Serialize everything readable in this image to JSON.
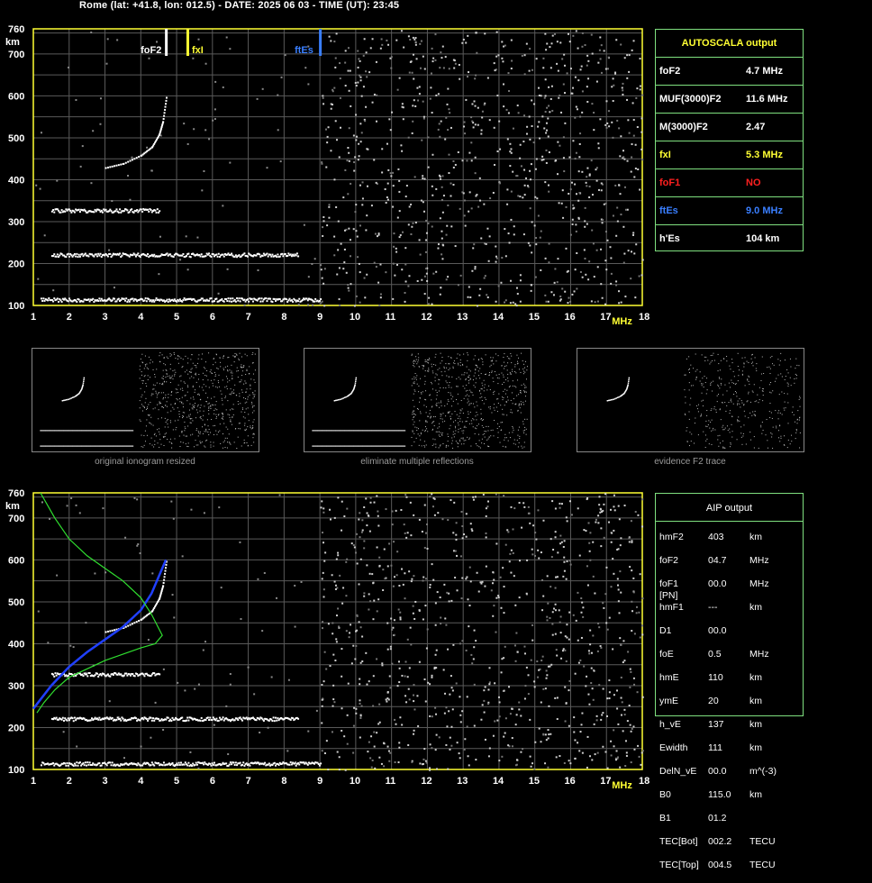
{
  "header": {
    "title": "Rome (lat: +41.8, lon: 012.5) - DATE: 2025 06 03 - TIME (UT): 23:45"
  },
  "axes": {
    "y_unit": "km",
    "x_unit": "MHz",
    "y_ticks": [
      "760",
      "700",
      "600",
      "500",
      "400",
      "300",
      "200",
      "100"
    ],
    "x_ticks": [
      "1",
      "2",
      "3",
      "4",
      "5",
      "6",
      "7",
      "8",
      "9",
      "10",
      "11",
      "12",
      "13",
      "14",
      "15",
      "16",
      "17",
      "18"
    ],
    "xlim": [
      1,
      18
    ],
    "ylim": [
      100,
      760
    ]
  },
  "markers": [
    {
      "label": "foF2",
      "freq": 4.7,
      "color": "#ffffff"
    },
    {
      "label": "fxI",
      "freq": 5.3,
      "color": "#ffff33"
    },
    {
      "label": "ftEs",
      "freq": 9.0,
      "color": "#3a7fff"
    }
  ],
  "autoscala": {
    "title": "AUTOSCALA output",
    "rows": [
      {
        "label": "foF2",
        "value": "4.7 MHz",
        "label_color": "#ffffff",
        "value_color": "#ffffff"
      },
      {
        "label": "MUF(3000)F2",
        "value": "11.6 MHz",
        "label_color": "#ffffff",
        "value_color": "#ffffff"
      },
      {
        "label": "M(3000)F2",
        "value": "2.47",
        "label_color": "#ffffff",
        "value_color": "#ffffff"
      },
      {
        "label": "fxI",
        "value": "5.3 MHz",
        "label_color": "#ffff33",
        "value_color": "#ffff33"
      },
      {
        "label": "foF1",
        "value": "NO",
        "label_color": "#ff2020",
        "value_color": "#ff2020"
      },
      {
        "label": "ftEs",
        "value": "9.0 MHz",
        "label_color": "#3a7fff",
        "value_color": "#3a7fff"
      },
      {
        "label": "h'Es",
        "value": "104    km",
        "label_color": "#ffffff",
        "value_color": "#ffffff"
      }
    ]
  },
  "thumbnails": [
    {
      "caption": "original ionogram resized"
    },
    {
      "caption": "eliminate multiple reflections"
    },
    {
      "caption": "evidence F2 trace"
    }
  ],
  "aip": {
    "title": "AIP output",
    "rows": [
      {
        "name": "hmF2",
        "value": "403",
        "unit": "km",
        "extra": ""
      },
      {
        "name": "foF2",
        "value": "04.7",
        "unit": "MHz",
        "extra": ""
      },
      {
        "name": "foF1",
        "value": "00.0",
        "unit": "MHz",
        "extra": "[PN]"
      },
      {
        "name": "hmF1",
        "value": "---",
        "unit": "km",
        "extra": ""
      },
      {
        "name": "D1",
        "value": "00.0",
        "unit": "",
        "extra": ""
      },
      {
        "name": "foE",
        "value": "0.5",
        "unit": "MHz",
        "extra": ""
      },
      {
        "name": "hmE",
        "value": "110",
        "unit": "km",
        "extra": ""
      },
      {
        "name": "ymE",
        "value": "20",
        "unit": "km",
        "extra": ""
      },
      {
        "name": "h_vE",
        "value": "137",
        "unit": "km",
        "extra": ""
      },
      {
        "name": "Ewidth",
        "value": "111",
        "unit": "km",
        "extra": ""
      },
      {
        "name": "DelN_vE",
        "value": "00.0",
        "unit": "m^(-3)",
        "extra": ""
      },
      {
        "name": "B0",
        "value": "115.0",
        "unit": "km",
        "extra": ""
      },
      {
        "name": "B1",
        "value": "01.2",
        "unit": "",
        "extra": ""
      },
      {
        "name": "TEC[Bot]",
        "value": "002.2",
        "unit": "TECU",
        "extra": ""
      },
      {
        "name": "TEC[Top]",
        "value": "004.5",
        "unit": "TECU",
        "extra": ""
      }
    ]
  },
  "chart_data": [
    {
      "type": "scatter",
      "title": "",
      "xlabel": "MHz",
      "ylabel": "km",
      "xlim": [
        1,
        18
      ],
      "ylim": [
        100,
        760
      ],
      "grid": true,
      "series": [
        {
          "x": [
            1.2,
            2,
            3,
            4,
            5,
            6,
            7,
            8,
            9
          ],
          "y": [
            115,
            115,
            115,
            115,
            115,
            115,
            115,
            115,
            115
          ]
        },
        {
          "x": [
            1.5,
            2,
            3,
            4,
            5,
            6,
            7,
            8,
            8.4
          ],
          "y": [
            222,
            222,
            222,
            222,
            222,
            222,
            222,
            222,
            222
          ]
        },
        {
          "x": [
            1.5,
            2,
            2.5,
            3,
            3.5,
            4,
            4.5
          ],
          "y": [
            328,
            328,
            328,
            328,
            328,
            328,
            328
          ]
        },
        {
          "x": [
            3.0,
            3.5,
            4.0,
            4.3,
            4.5,
            4.6,
            4.7
          ],
          "y": [
            430,
            440,
            460,
            480,
            510,
            540,
            600
          ]
        }
      ]
    },
    {
      "type": "line",
      "title": "",
      "xlabel": "MHz",
      "ylabel": "km",
      "xlim": [
        1,
        18
      ],
      "ylim": [
        100,
        760
      ],
      "grid": true,
      "series": [
        {
          "color": "#2040ff",
          "x": [
            1.0,
            1.5,
            2.0,
            2.5,
            3.0,
            3.5,
            4.0,
            4.3,
            4.5,
            4.7
          ],
          "y": [
            245,
            300,
            345,
            380,
            410,
            440,
            480,
            520,
            560,
            600
          ]
        },
        {
          "color": "#30e030",
          "x": [
            1.2,
            1.6,
            2.0,
            2.5,
            3.0,
            3.5,
            4.0,
            4.3,
            4.6,
            4.4,
            4.0,
            3.0,
            2.0,
            1.6,
            1.3,
            1.1
          ],
          "y": [
            760,
            700,
            650,
            610,
            580,
            550,
            510,
            470,
            420,
            400,
            390,
            360,
            320,
            290,
            260,
            235
          ]
        }
      ]
    }
  ]
}
